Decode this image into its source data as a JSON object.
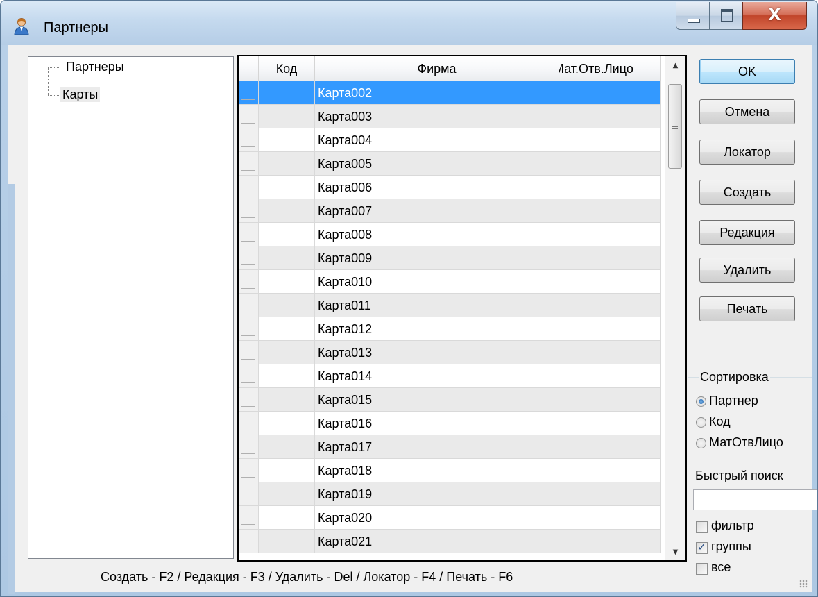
{
  "window": {
    "title": "Партнеры",
    "close_glyph": "X"
  },
  "tree": {
    "items": [
      {
        "label": "Партнеры"
      },
      {
        "label": "Карты"
      }
    ]
  },
  "grid": {
    "columns": [
      "",
      "Код",
      "Фирма",
      "Мат.Отв.Лицо"
    ],
    "selected_row": 0,
    "rows": [
      {
        "kod": "",
        "firma": "Карта002",
        "mat": ""
      },
      {
        "kod": "",
        "firma": "Карта003",
        "mat": ""
      },
      {
        "kod": "",
        "firma": "Карта004",
        "mat": ""
      },
      {
        "kod": "",
        "firma": "Карта005",
        "mat": ""
      },
      {
        "kod": "",
        "firma": "Карта006",
        "mat": ""
      },
      {
        "kod": "",
        "firma": "Карта007",
        "mat": ""
      },
      {
        "kod": "",
        "firma": "Карта008",
        "mat": ""
      },
      {
        "kod": "",
        "firma": "Карта009",
        "mat": ""
      },
      {
        "kod": "",
        "firma": "Карта010",
        "mat": ""
      },
      {
        "kod": "",
        "firma": "Карта011",
        "mat": ""
      },
      {
        "kod": "",
        "firma": "Карта012",
        "mat": ""
      },
      {
        "kod": "",
        "firma": "Карта013",
        "mat": ""
      },
      {
        "kod": "",
        "firma": "Карта014",
        "mat": ""
      },
      {
        "kod": "",
        "firma": "Карта015",
        "mat": ""
      },
      {
        "kod": "",
        "firma": "Карта016",
        "mat": ""
      },
      {
        "kod": "",
        "firma": "Карта017",
        "mat": ""
      },
      {
        "kod": "",
        "firma": "Карта018",
        "mat": ""
      },
      {
        "kod": "",
        "firma": "Карта019",
        "mat": ""
      },
      {
        "kod": "",
        "firma": "Карта020",
        "mat": ""
      },
      {
        "kod": "",
        "firma": "Карта021",
        "mat": ""
      }
    ]
  },
  "buttons": {
    "ok": "OK",
    "cancel": "Отмена",
    "locator": "Локатор",
    "create": "Создать",
    "edit": "Редакция",
    "delete": "Удалить",
    "print": "Печать"
  },
  "sorting": {
    "label": "Сортировка",
    "options": [
      "Партнер",
      "Код",
      "МатОтвЛицо"
    ],
    "selected": "Партнер"
  },
  "quick_search": {
    "label": "Быстрый поиск",
    "value": ""
  },
  "checkboxes": [
    {
      "label": "фильтр",
      "checked": false
    },
    {
      "label": "группы",
      "checked": true
    },
    {
      "label": "все",
      "checked": false
    }
  ],
  "status_text": "Создать - F2 / Редакция - F3 / Удалить - Del / Локатор - F4 / Печать - F6"
}
